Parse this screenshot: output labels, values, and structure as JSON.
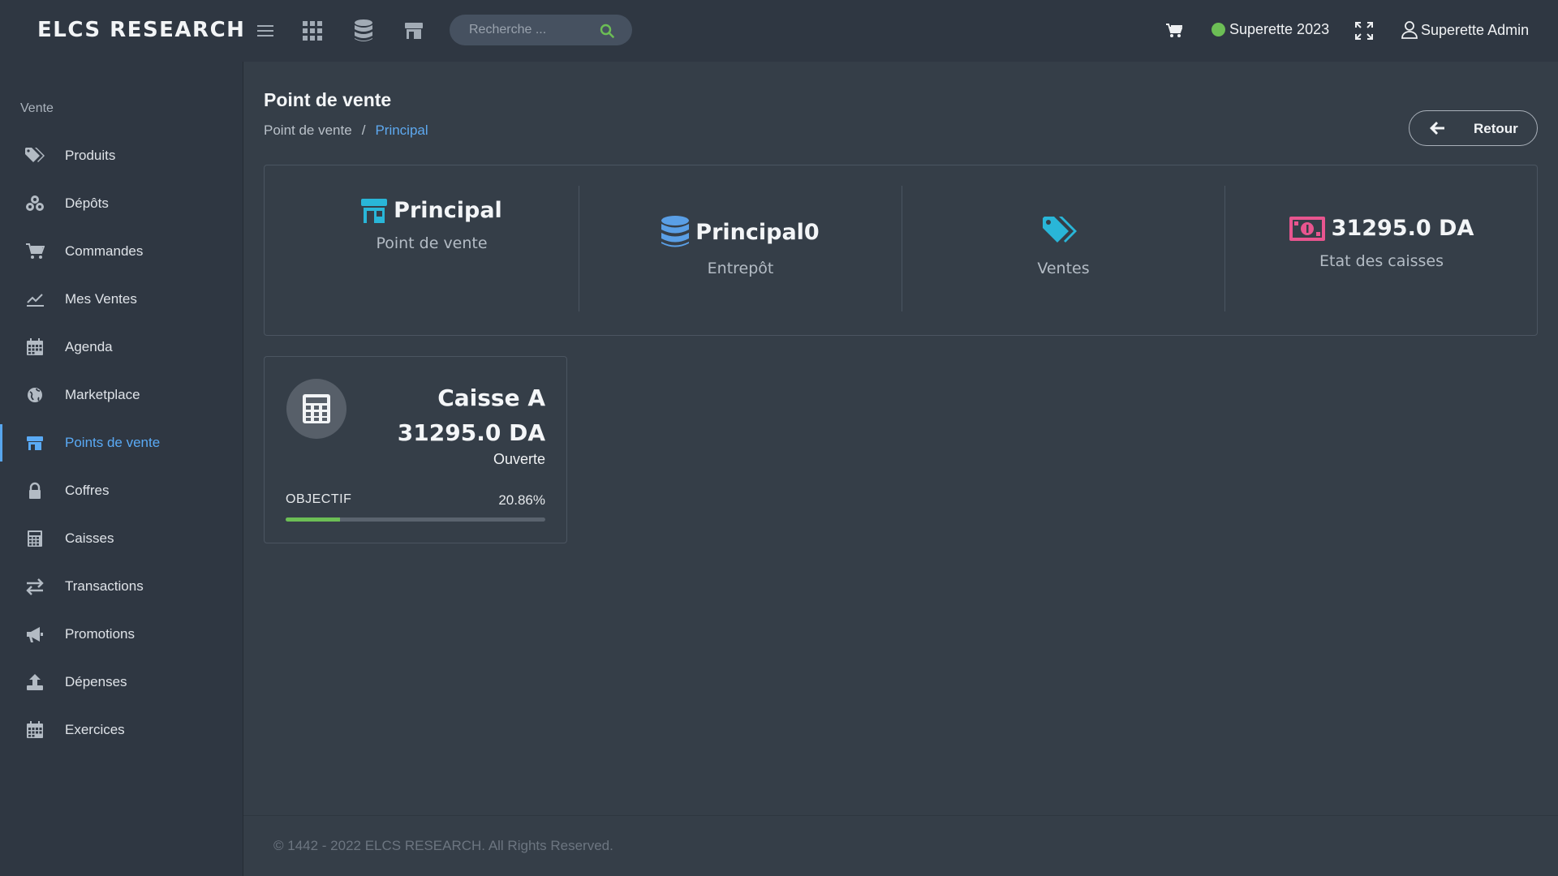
{
  "app": {
    "brand": "ELCS RESEARCH"
  },
  "topbar": {
    "search": {
      "placeholder": "Recherche ..."
    },
    "company": "Superette 2023",
    "user": "Superette Admin"
  },
  "sidebar": {
    "section": "Vente",
    "items": [
      {
        "label": "Produits",
        "icon": "tags-icon"
      },
      {
        "label": "Dépôts",
        "icon": "boxes-icon"
      },
      {
        "label": "Commandes",
        "icon": "cart-icon"
      },
      {
        "label": "Mes Ventes",
        "icon": "chart-line-icon"
      },
      {
        "label": "Agenda",
        "icon": "calendar-icon"
      },
      {
        "label": "Marketplace",
        "icon": "globe-icon"
      },
      {
        "label": "Points de vente",
        "icon": "store-icon",
        "active": true
      },
      {
        "label": "Coffres",
        "icon": "lock-icon"
      },
      {
        "label": "Caisses",
        "icon": "calculator-icon"
      },
      {
        "label": "Transactions",
        "icon": "exchange-icon"
      },
      {
        "label": "Promotions",
        "icon": "megaphone-icon"
      },
      {
        "label": "Dépenses",
        "icon": "upload-icon"
      },
      {
        "label": "Exercices",
        "icon": "calendar-icon"
      }
    ]
  },
  "main": {
    "title": "Point de vente",
    "breadcrumb": [
      "Point de vente",
      "Principal"
    ],
    "back_label": "Retour",
    "stats": [
      {
        "value": "Principal",
        "label": "Point de vente",
        "icon": "store-icon",
        "color": "#29b6d8"
      },
      {
        "value": "Principal0",
        "label": "Entrepôt",
        "icon": "database-icon",
        "color": "#5a9fe6"
      },
      {
        "value": "",
        "label": "Ventes",
        "icon": "tags-icon",
        "color": "#29b6d8"
      },
      {
        "value": "31295.0 DA",
        "label": "Etat des caisses",
        "icon": "money-bill-icon",
        "color": "#e8558f"
      }
    ],
    "register": {
      "name": "Caisse A",
      "amount": "31295.0 DA",
      "status": "Ouverte",
      "objective_label": "OBJECTIF",
      "objective_pct_text": "20.86%",
      "objective_fraction": 0.2086,
      "bar_color": "#6cbe55"
    }
  },
  "footer": {
    "text": "© 1442 - 2022 ELCS RESEARCH. All Rights Reserved."
  }
}
